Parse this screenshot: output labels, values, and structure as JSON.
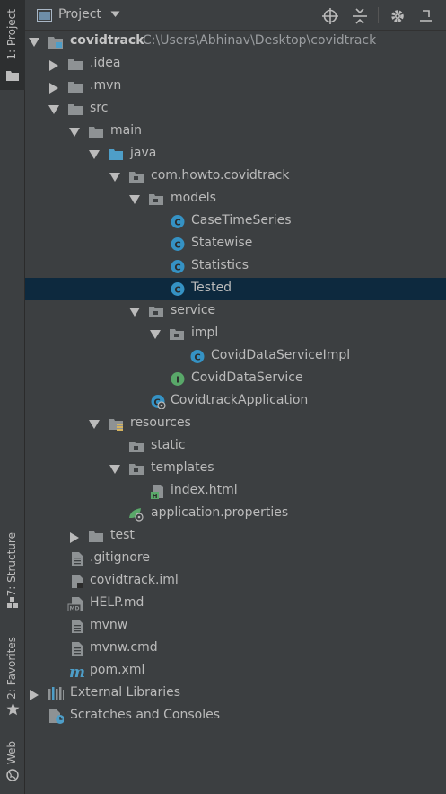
{
  "sidebar": {
    "project_tab": "1: Project",
    "structure_tab": "7: Structure",
    "favorites_tab": "2: Favorites",
    "web_tab": "Web"
  },
  "header": {
    "title": "Project"
  },
  "tree": {
    "root": {
      "label": "covidtrack",
      "path": "C:\\Users\\Abhinav\\Desktop\\covidtrack"
    },
    "idea": ".idea",
    "mvn": ".mvn",
    "src": "src",
    "main": "main",
    "java": "java",
    "package": "com.howto.covidtrack",
    "models": "models",
    "case_time_series": "CaseTimeSeries",
    "statewise": "Statewise",
    "statistics": "Statistics",
    "tested": "Tested",
    "service": "service",
    "impl": "impl",
    "service_impl": "CovidDataServiceImpl",
    "data_service": "CovidDataService",
    "application": "CovidtrackApplication",
    "resources": "resources",
    "static": "static",
    "templates": "templates",
    "index_html": "index.html",
    "app_properties": "application.properties",
    "test": "test",
    "gitignore": ".gitignore",
    "iml": "covidtrack.iml",
    "help_md": "HELP.md",
    "mvnw": "mvnw",
    "mvnw_cmd": "mvnw.cmd",
    "pom": "pom.xml",
    "external_libraries": "External Libraries",
    "scratches": "Scratches and Consoles"
  },
  "colors": {
    "selection": "#0d293e",
    "folder": "#8e9294",
    "source_folder": "#4e9ec8",
    "class_icon": "#3592c4",
    "interface_icon": "#59a869"
  }
}
